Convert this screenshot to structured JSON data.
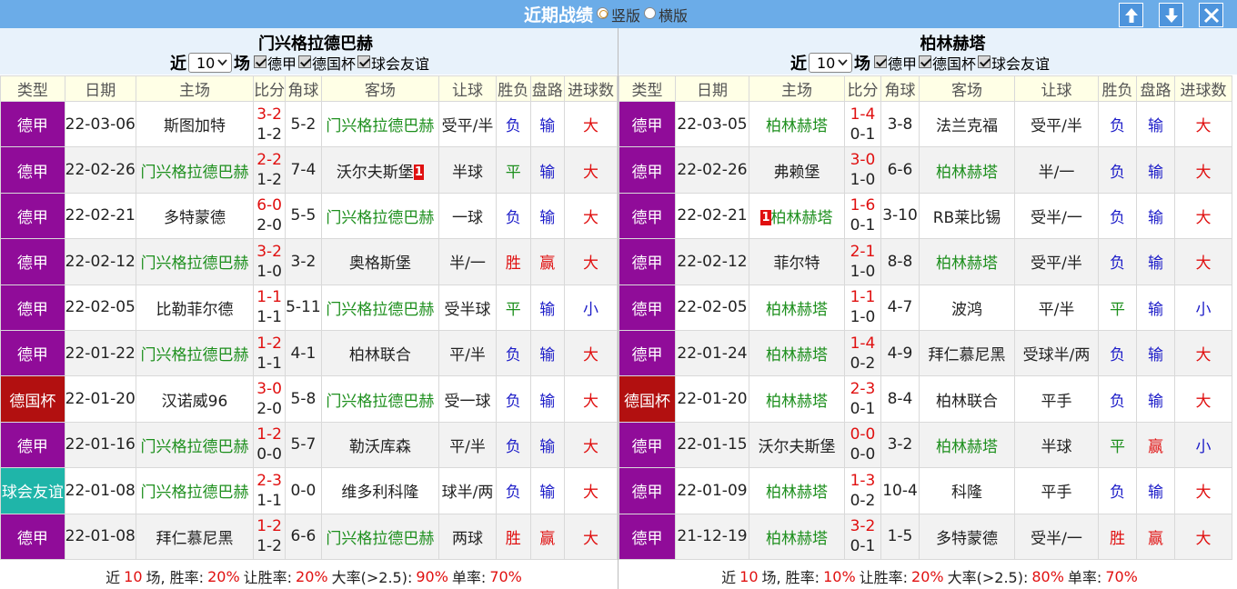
{
  "header": {
    "title": "近期战绩",
    "options": [
      {
        "label": "竖版",
        "selected": true
      },
      {
        "label": "横版",
        "selected": false
      }
    ],
    "buttons": [
      "up-arrow-icon",
      "down-arrow-icon",
      "close-icon"
    ],
    "accent_color": "#6bace8"
  },
  "panels": [
    {
      "team": "门兴格拉德巴赫",
      "recent_prefix": "近",
      "recent_count": "10",
      "recent_suffix": "场",
      "filters": [
        "德甲",
        "德国杯",
        "球会友谊"
      ],
      "columns": [
        "类型",
        "日期",
        "主场",
        "比分",
        "角球",
        "客场",
        "让球",
        "胜负",
        "盘路",
        "进球数"
      ],
      "rows": [
        {
          "league": "德甲",
          "league_style": "bundesliga",
          "date": "22-03-06",
          "home": "斯图加特",
          "home_style": "dark",
          "home_card": "",
          "ft": "3-2",
          "ht": "1-2",
          "corner": "5-2",
          "away": "门兴格拉德巴赫",
          "away_style": "green",
          "away_card": "",
          "handicap": "受平/半",
          "result": "负",
          "result_style": "blue",
          "pan": "输",
          "pan_style": "blue",
          "goals": "大",
          "goals_style": "red"
        },
        {
          "league": "德甲",
          "league_style": "bundesliga",
          "date": "22-02-26",
          "home": "门兴格拉德巴赫",
          "home_style": "green",
          "home_card": "",
          "ft": "2-2",
          "ht": "1-2",
          "corner": "7-4",
          "away": "沃尔夫斯堡",
          "away_style": "dark",
          "away_card": "1",
          "handicap": "半球",
          "result": "平",
          "result_style": "green",
          "pan": "输",
          "pan_style": "blue",
          "goals": "大",
          "goals_style": "red"
        },
        {
          "league": "德甲",
          "league_style": "bundesliga",
          "date": "22-02-21",
          "home": "多特蒙德",
          "home_style": "dark",
          "home_card": "",
          "ft": "6-0",
          "ht": "2-0",
          "corner": "5-5",
          "away": "门兴格拉德巴赫",
          "away_style": "green",
          "away_card": "",
          "handicap": "一球",
          "result": "负",
          "result_style": "blue",
          "pan": "输",
          "pan_style": "blue",
          "goals": "大",
          "goals_style": "red"
        },
        {
          "league": "德甲",
          "league_style": "bundesliga",
          "date": "22-02-12",
          "home": "门兴格拉德巴赫",
          "home_style": "green",
          "home_card": "",
          "ft": "3-2",
          "ht": "1-0",
          "corner": "3-2",
          "away": "奥格斯堡",
          "away_style": "dark",
          "away_card": "",
          "handicap": "半/一",
          "result": "胜",
          "result_style": "red",
          "pan": "赢",
          "pan_style": "red",
          "goals": "大",
          "goals_style": "red"
        },
        {
          "league": "德甲",
          "league_style": "bundesliga",
          "date": "22-02-05",
          "home": "比勒菲尔德",
          "home_style": "dark",
          "home_card": "",
          "ft": "1-1",
          "ht": "1-1",
          "corner": "5-11",
          "away": "门兴格拉德巴赫",
          "away_style": "green",
          "away_card": "",
          "handicap": "受半球",
          "result": "平",
          "result_style": "green",
          "pan": "输",
          "pan_style": "blue",
          "goals": "小",
          "goals_style": "blue"
        },
        {
          "league": "德甲",
          "league_style": "bundesliga",
          "date": "22-01-22",
          "home": "门兴格拉德巴赫",
          "home_style": "green",
          "home_card": "",
          "ft": "1-2",
          "ht": "1-1",
          "corner": "4-1",
          "away": "柏林联合",
          "away_style": "dark",
          "away_card": "",
          "handicap": "平/半",
          "result": "负",
          "result_style": "blue",
          "pan": "输",
          "pan_style": "blue",
          "goals": "大",
          "goals_style": "red"
        },
        {
          "league": "德国杯",
          "league_style": "cup",
          "date": "22-01-20",
          "home": "汉诺威96",
          "home_style": "dark",
          "home_card": "",
          "ft": "3-0",
          "ht": "2-0",
          "corner": "5-8",
          "away": "门兴格拉德巴赫",
          "away_style": "green",
          "away_card": "",
          "handicap": "受一球",
          "result": "负",
          "result_style": "blue",
          "pan": "输",
          "pan_style": "blue",
          "goals": "大",
          "goals_style": "red"
        },
        {
          "league": "德甲",
          "league_style": "bundesliga",
          "date": "22-01-16",
          "home": "门兴格拉德巴赫",
          "home_style": "green",
          "home_card": "",
          "ft": "1-2",
          "ht": "0-0",
          "corner": "5-7",
          "away": "勒沃库森",
          "away_style": "dark",
          "away_card": "",
          "handicap": "平/半",
          "result": "负",
          "result_style": "blue",
          "pan": "输",
          "pan_style": "blue",
          "goals": "大",
          "goals_style": "red"
        },
        {
          "league": "球会友谊",
          "league_style": "friendly",
          "date": "22-01-08",
          "home": "门兴格拉德巴赫",
          "home_style": "green",
          "home_card": "",
          "ft": "2-3",
          "ht": "1-1",
          "corner": "0-0",
          "away": "维多利科隆",
          "away_style": "dark",
          "away_card": "",
          "handicap": "球半/两",
          "result": "负",
          "result_style": "blue",
          "pan": "输",
          "pan_style": "blue",
          "goals": "大",
          "goals_style": "red"
        },
        {
          "league": "德甲",
          "league_style": "bundesliga",
          "date": "22-01-08",
          "home": "拜仁慕尼黑",
          "home_style": "dark",
          "home_card": "",
          "ft": "1-2",
          "ht": "1-2",
          "corner": "6-6",
          "away": "门兴格拉德巴赫",
          "away_style": "green",
          "away_card": "",
          "handicap": "两球",
          "result": "胜",
          "result_style": "red",
          "pan": "赢",
          "pan_style": "red",
          "goals": "大",
          "goals_style": "red"
        }
      ],
      "summary": {
        "pre": "近",
        "count": "10",
        "mid": "场, 胜率:",
        "win_rate": "20%",
        "handicap_label": "让胜率:",
        "handicap_rate": "20%",
        "over_label": "大率(>2.5):",
        "over_rate": "90%",
        "odd_label": "单率:",
        "odd_rate": "70%"
      }
    },
    {
      "team": "柏林赫塔",
      "recent_prefix": "近",
      "recent_count": "10",
      "recent_suffix": "场",
      "filters": [
        "德甲",
        "德国杯",
        "球会友谊"
      ],
      "columns": [
        "类型",
        "日期",
        "主场",
        "比分",
        "角球",
        "客场",
        "让球",
        "胜负",
        "盘路",
        "进球数"
      ],
      "rows": [
        {
          "league": "德甲",
          "league_style": "bundesliga",
          "date": "22-03-05",
          "home": "柏林赫塔",
          "home_style": "green",
          "home_card": "",
          "ft": "1-4",
          "ht": "0-1",
          "corner": "3-8",
          "away": "法兰克福",
          "away_style": "dark",
          "away_card": "",
          "handicap": "受平/半",
          "result": "负",
          "result_style": "blue",
          "pan": "输",
          "pan_style": "blue",
          "goals": "大",
          "goals_style": "red"
        },
        {
          "league": "德甲",
          "league_style": "bundesliga",
          "date": "22-02-26",
          "home": "弗赖堡",
          "home_style": "dark",
          "home_card": "",
          "ft": "3-0",
          "ht": "1-0",
          "corner": "6-6",
          "away": "柏林赫塔",
          "away_style": "green",
          "away_card": "",
          "handicap": "半/一",
          "result": "负",
          "result_style": "blue",
          "pan": "输",
          "pan_style": "blue",
          "goals": "大",
          "goals_style": "red"
        },
        {
          "league": "德甲",
          "league_style": "bundesliga",
          "date": "22-02-21",
          "home": "柏林赫塔",
          "home_style": "green",
          "home_card": "1",
          "ft": "1-6",
          "ht": "0-1",
          "corner": "3-10",
          "away": "RB莱比锡",
          "away_style": "dark",
          "away_card": "",
          "handicap": "受半/一",
          "result": "负",
          "result_style": "blue",
          "pan": "输",
          "pan_style": "blue",
          "goals": "大",
          "goals_style": "red"
        },
        {
          "league": "德甲",
          "league_style": "bundesliga",
          "date": "22-02-12",
          "home": "菲尔特",
          "home_style": "dark",
          "home_card": "",
          "ft": "2-1",
          "ht": "1-0",
          "corner": "8-8",
          "away": "柏林赫塔",
          "away_style": "green",
          "away_card": "",
          "handicap": "受平/半",
          "result": "负",
          "result_style": "blue",
          "pan": "输",
          "pan_style": "blue",
          "goals": "大",
          "goals_style": "red"
        },
        {
          "league": "德甲",
          "league_style": "bundesliga",
          "date": "22-02-05",
          "home": "柏林赫塔",
          "home_style": "green",
          "home_card": "",
          "ft": "1-1",
          "ht": "1-0",
          "corner": "4-7",
          "away": "波鸿",
          "away_style": "dark",
          "away_card": "",
          "handicap": "平/半",
          "result": "平",
          "result_style": "green",
          "pan": "输",
          "pan_style": "blue",
          "goals": "小",
          "goals_style": "blue"
        },
        {
          "league": "德甲",
          "league_style": "bundesliga",
          "date": "22-01-24",
          "home": "柏林赫塔",
          "home_style": "green",
          "home_card": "",
          "ft": "1-4",
          "ht": "0-2",
          "corner": "4-9",
          "away": "拜仁慕尼黑",
          "away_style": "dark",
          "away_card": "",
          "handicap": "受球半/两",
          "result": "负",
          "result_style": "blue",
          "pan": "输",
          "pan_style": "blue",
          "goals": "大",
          "goals_style": "red"
        },
        {
          "league": "德国杯",
          "league_style": "cup",
          "date": "22-01-20",
          "home": "柏林赫塔",
          "home_style": "green",
          "home_card": "",
          "ft": "2-3",
          "ht": "0-1",
          "corner": "8-4",
          "away": "柏林联合",
          "away_style": "dark",
          "away_card": "",
          "handicap": "平手",
          "result": "负",
          "result_style": "blue",
          "pan": "输",
          "pan_style": "blue",
          "goals": "大",
          "goals_style": "red"
        },
        {
          "league": "德甲",
          "league_style": "bundesliga",
          "date": "22-01-15",
          "home": "沃尔夫斯堡",
          "home_style": "dark",
          "home_card": "",
          "ft": "0-0",
          "ht": "0-0",
          "corner": "3-2",
          "away": "柏林赫塔",
          "away_style": "green",
          "away_card": "",
          "handicap": "半球",
          "result": "平",
          "result_style": "green",
          "pan": "赢",
          "pan_style": "red",
          "goals": "小",
          "goals_style": "blue"
        },
        {
          "league": "德甲",
          "league_style": "bundesliga",
          "date": "22-01-09",
          "home": "柏林赫塔",
          "home_style": "green",
          "home_card": "",
          "ft": "1-3",
          "ht": "0-2",
          "corner": "10-4",
          "away": "科隆",
          "away_style": "dark",
          "away_card": "",
          "handicap": "平手",
          "result": "负",
          "result_style": "blue",
          "pan": "输",
          "pan_style": "blue",
          "goals": "大",
          "goals_style": "red"
        },
        {
          "league": "德甲",
          "league_style": "bundesliga",
          "date": "21-12-19",
          "home": "柏林赫塔",
          "home_style": "green",
          "home_card": "",
          "ft": "3-2",
          "ht": "0-1",
          "corner": "1-5",
          "away": "多特蒙德",
          "away_style": "dark",
          "away_card": "",
          "handicap": "受半/一",
          "result": "胜",
          "result_style": "red",
          "pan": "赢",
          "pan_style": "red",
          "goals": "大",
          "goals_style": "red"
        }
      ],
      "summary": {
        "pre": "近",
        "count": "10",
        "mid": "场, 胜率:",
        "win_rate": "10%",
        "handicap_label": "让胜率:",
        "handicap_rate": "20%",
        "over_label": "大率(>2.5):",
        "over_rate": "80%",
        "odd_label": "单率:",
        "odd_rate": "70%"
      }
    }
  ],
  "colors": {
    "bundesliga": "#900c99",
    "cup": "#b21010",
    "friendly": "#1fb5a9",
    "win": "#e01010",
    "loss": "#1c1cc8",
    "draw": "#1d8f1d"
  }
}
